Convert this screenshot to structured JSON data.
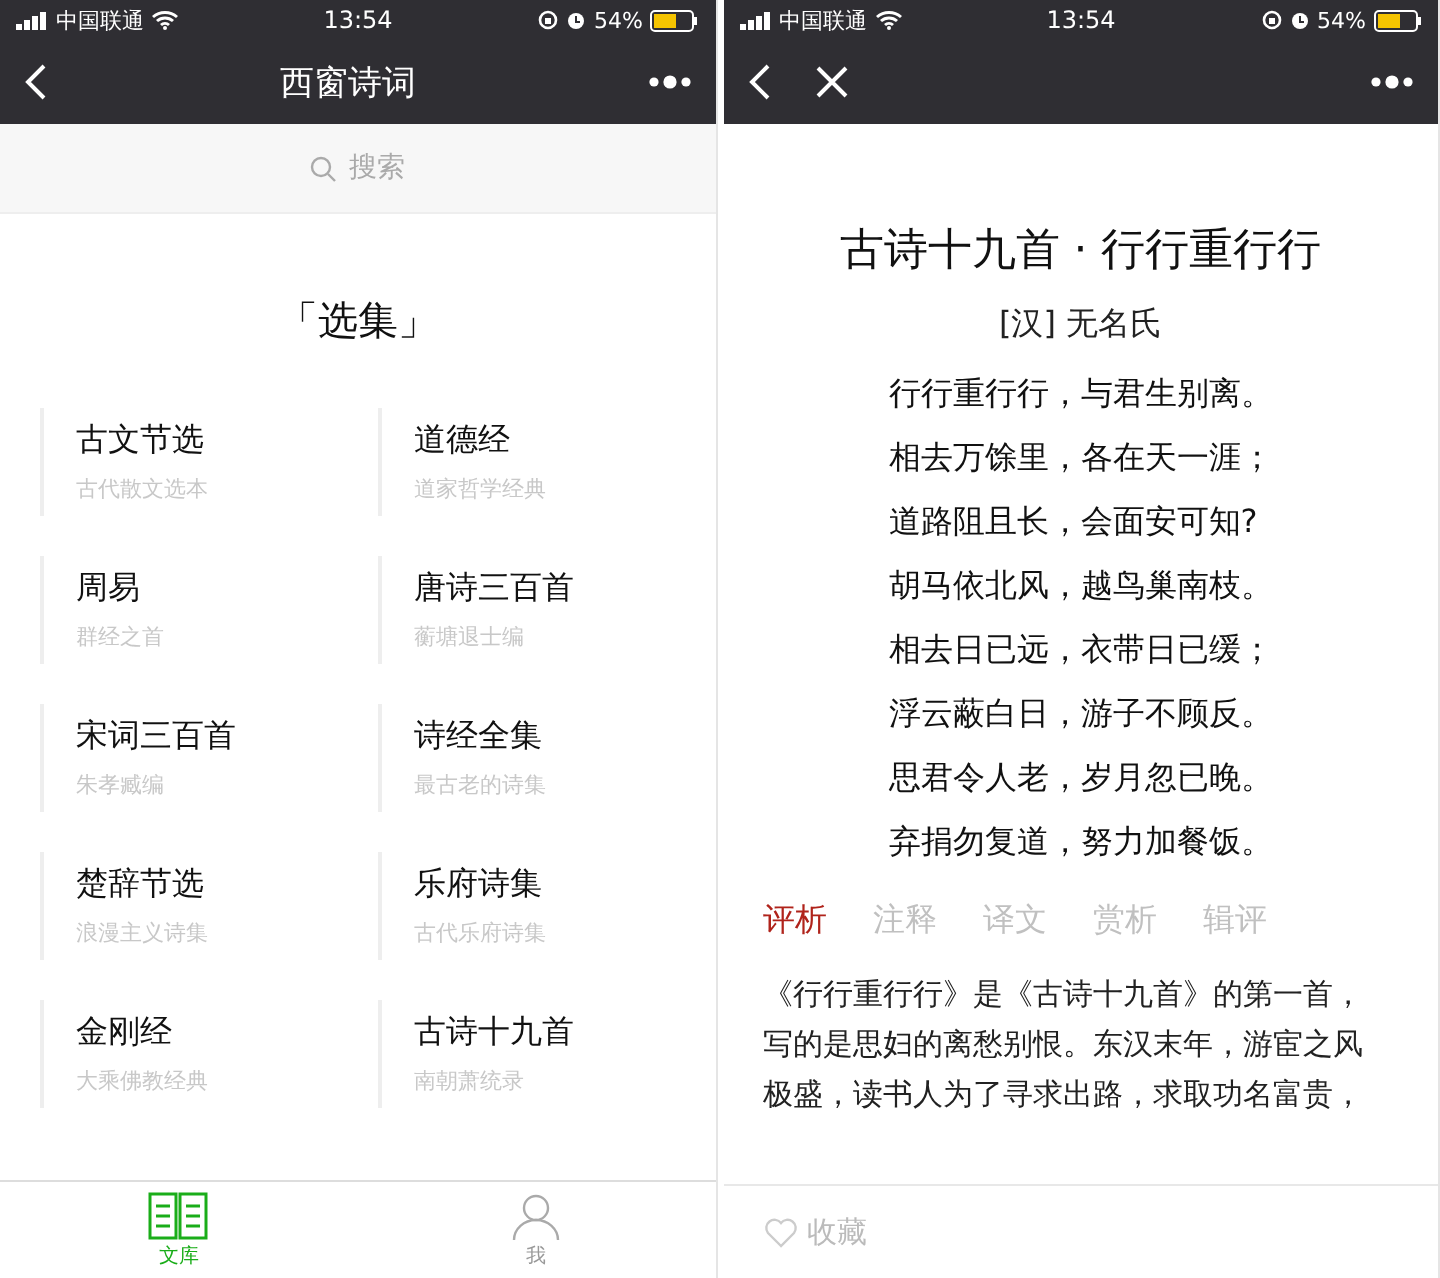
{
  "library_screen": {
    "status_bar": {
      "carrier": "中国联通",
      "time": "13:54",
      "battery": "54%"
    },
    "nav_title": "西窗诗词",
    "search": {
      "placeholder": "搜索"
    },
    "section_title": "「选集」",
    "collections": [
      {
        "title": "古文节选",
        "subtitle": "古代散文选本"
      },
      {
        "title": "道德经",
        "subtitle": "道家哲学经典"
      },
      {
        "title": "周易",
        "subtitle": "群经之首"
      },
      {
        "title": "唐诗三百首",
        "subtitle": "蘅塘退士编"
      },
      {
        "title": "宋词三百首",
        "subtitle": "朱孝臧编"
      },
      {
        "title": "诗经全集",
        "subtitle": "最古老的诗集"
      },
      {
        "title": "楚辞节选",
        "subtitle": "浪漫主义诗集"
      },
      {
        "title": "乐府诗集",
        "subtitle": "古代乐府诗集"
      },
      {
        "title": "金刚经",
        "subtitle": "大乘佛教经典"
      },
      {
        "title": "古诗十九首",
        "subtitle": "南朝萧统录"
      }
    ],
    "tab_bar": [
      {
        "label": "文库",
        "kind": "library",
        "selected": true
      },
      {
        "label": "我",
        "kind": "profile",
        "selected": false
      }
    ]
  },
  "poem_screen": {
    "status_bar": {
      "carrier": "中国联通",
      "time": "13:54",
      "battery": "54%"
    },
    "title": "古诗十九首 · 行行重行行",
    "author": "[汉] 无名氏",
    "lines": [
      "行行重行行，与君生别离。",
      "相去万馀里，各在天一涯；",
      "道路阻且长，会面安可知?",
      "胡马依北风，越鸟巢南枝。",
      "相去日已远，衣带日已缓；",
      "浮云蔽白日，游子不顾反。",
      "思君令人老，岁月忽已晚。",
      "弃捐勿复道，努力加餐饭。"
    ],
    "tabs": [
      {
        "label": "评析",
        "selected": true
      },
      {
        "label": "注释",
        "selected": false
      },
      {
        "label": "译文",
        "selected": false
      },
      {
        "label": "赏析",
        "selected": false
      },
      {
        "label": "辑评",
        "selected": false
      }
    ],
    "analysis": "《行行重行行》是《古诗十九首》的第一首，写的是思妇的离愁别恨。东汉末年，游宦之风极盛，读书人为了寻求出路，求取功名富贵，",
    "favorite": {
      "label": "收藏",
      "checked": false
    }
  }
}
